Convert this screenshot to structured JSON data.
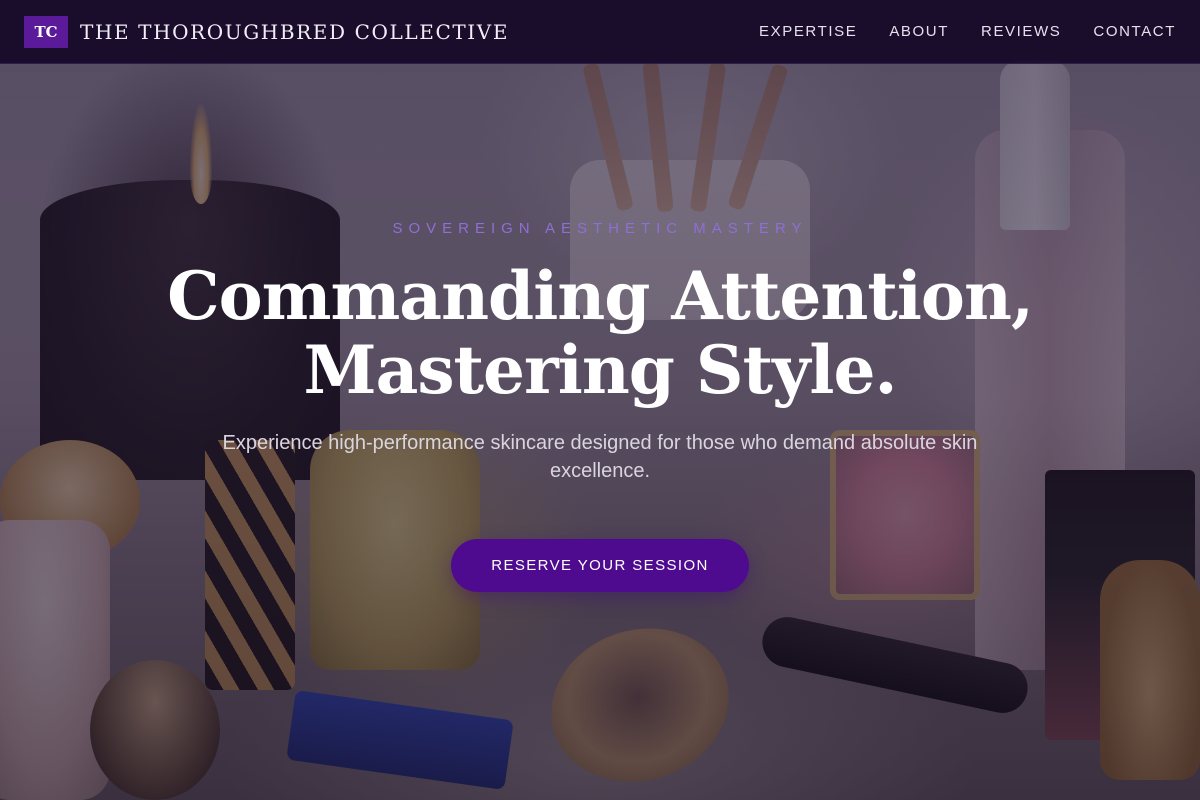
{
  "nav": {
    "logo_text": "TC",
    "brand_name": "THE THOROUGHBRED COLLECTIVE",
    "links": [
      "EXPERTISE",
      "ABOUT",
      "REVIEWS",
      "CONTACT"
    ]
  },
  "hero": {
    "eyebrow": "SOVEREIGN AESTHETIC MASTERY",
    "headline_line1": "Commanding Attention,",
    "headline_line2": "Mastering Style.",
    "subheadline": "Experience high-performance skincare designed for those who demand absolute skin excellence.",
    "cta_label": "RESERVE YOUR SESSION",
    "background_image": "makeup-and-skincare-products-photo"
  },
  "colors": {
    "nav_bg": "#14082A",
    "accent_purple": "#4F0B8F",
    "logo_bg": "#5A1A9A",
    "eyebrow": "#8E6FD6"
  }
}
